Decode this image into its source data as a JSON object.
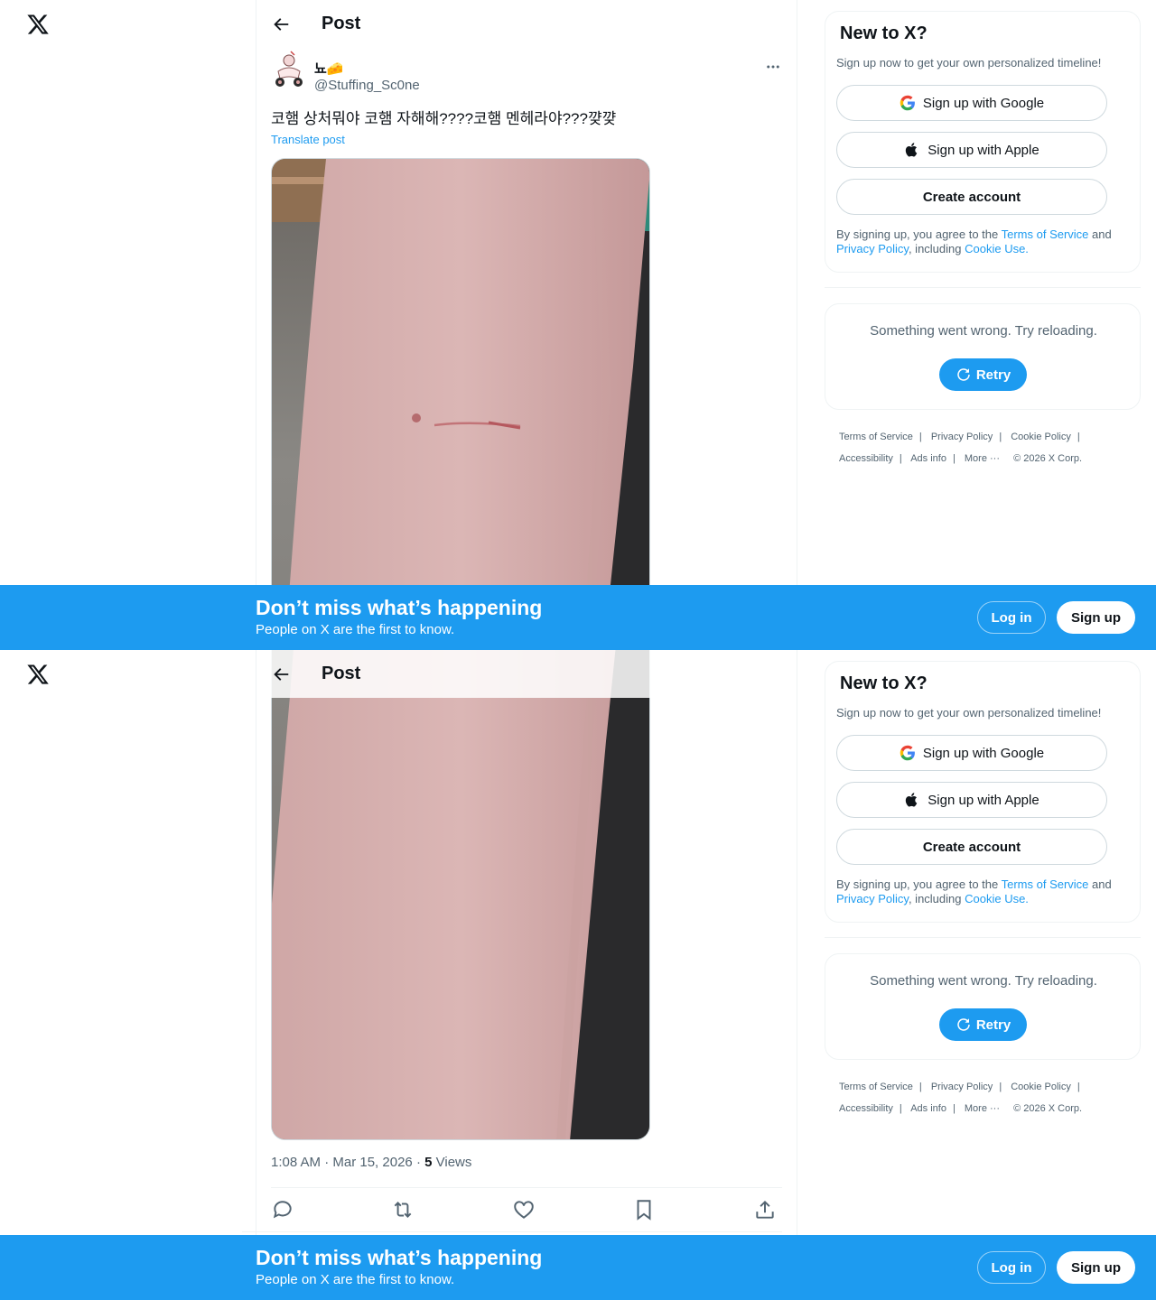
{
  "header": {
    "title": "Post"
  },
  "tweet": {
    "author_name": "뇨🧀",
    "author_handle": "@Stuffing_Sc0ne",
    "text": "코햄 상처뭐야 코햄 자해해????코햄 멘헤라야???꺚꺚",
    "translate_label": "Translate post",
    "time": "1:08 AM · Mar 15, 2026",
    "views_count": "5",
    "views_label": "Views"
  },
  "signup_card": {
    "title": "New to X?",
    "subtitle": "Sign up now to get your own personalized timeline!",
    "google_label": "Sign up with Google",
    "apple_label": "Sign up with Apple",
    "create_label": "Create account",
    "legal_prefix": "By signing up, you agree to the ",
    "terms_link": "Terms of Service",
    "legal_and": " and ",
    "privacy_link": "Privacy Policy",
    "legal_including": ", including ",
    "cookie_link": "Cookie Use."
  },
  "error_card": {
    "message": "Something went wrong. Try reloading.",
    "retry_label": "Retry"
  },
  "footer": {
    "links": [
      "Terms of Service",
      "Privacy Policy",
      "Cookie Policy",
      "Accessibility",
      "Ads info",
      "More ···"
    ],
    "copyright": "© 2026 X Corp."
  },
  "banner": {
    "title": "Don’t miss what’s happening",
    "subtitle": "People on X are the first to know.",
    "login_label": "Log in",
    "signup_label": "Sign up"
  },
  "colors": {
    "accent": "#1d9bf0",
    "text": "#0f1419",
    "secondary": "#536471",
    "border": "#eff3f4"
  },
  "icons": [
    "x-logo-icon",
    "back-arrow-icon",
    "more-icon",
    "google-icon",
    "apple-icon",
    "retry-icon",
    "reply-icon",
    "repost-icon",
    "like-icon",
    "bookmark-icon",
    "share-icon"
  ]
}
